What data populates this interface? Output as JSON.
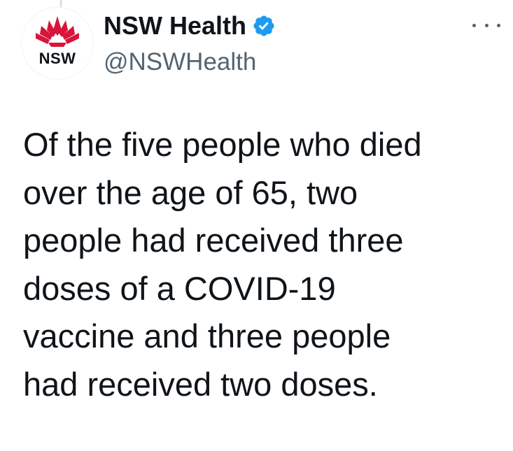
{
  "account": {
    "avatar_text": "NSW",
    "display_name": "NSW Health",
    "handle": "@NSWHealth",
    "verified": true
  },
  "tweet": {
    "text": "Of the five people who died\nover the age of 65, two\npeople had received three\ndoses of a COVID-19\nvaccine and three people\nhad received two doses."
  },
  "colors": {
    "verified_badge": "#1d9bf0",
    "waratah_red": "#d7153a",
    "handle_gray": "#536471",
    "text": "#0f1419"
  },
  "icons": {
    "verified": "verified-badge-icon",
    "more": "more-options-icon",
    "logo": "waratah-logo-icon"
  }
}
